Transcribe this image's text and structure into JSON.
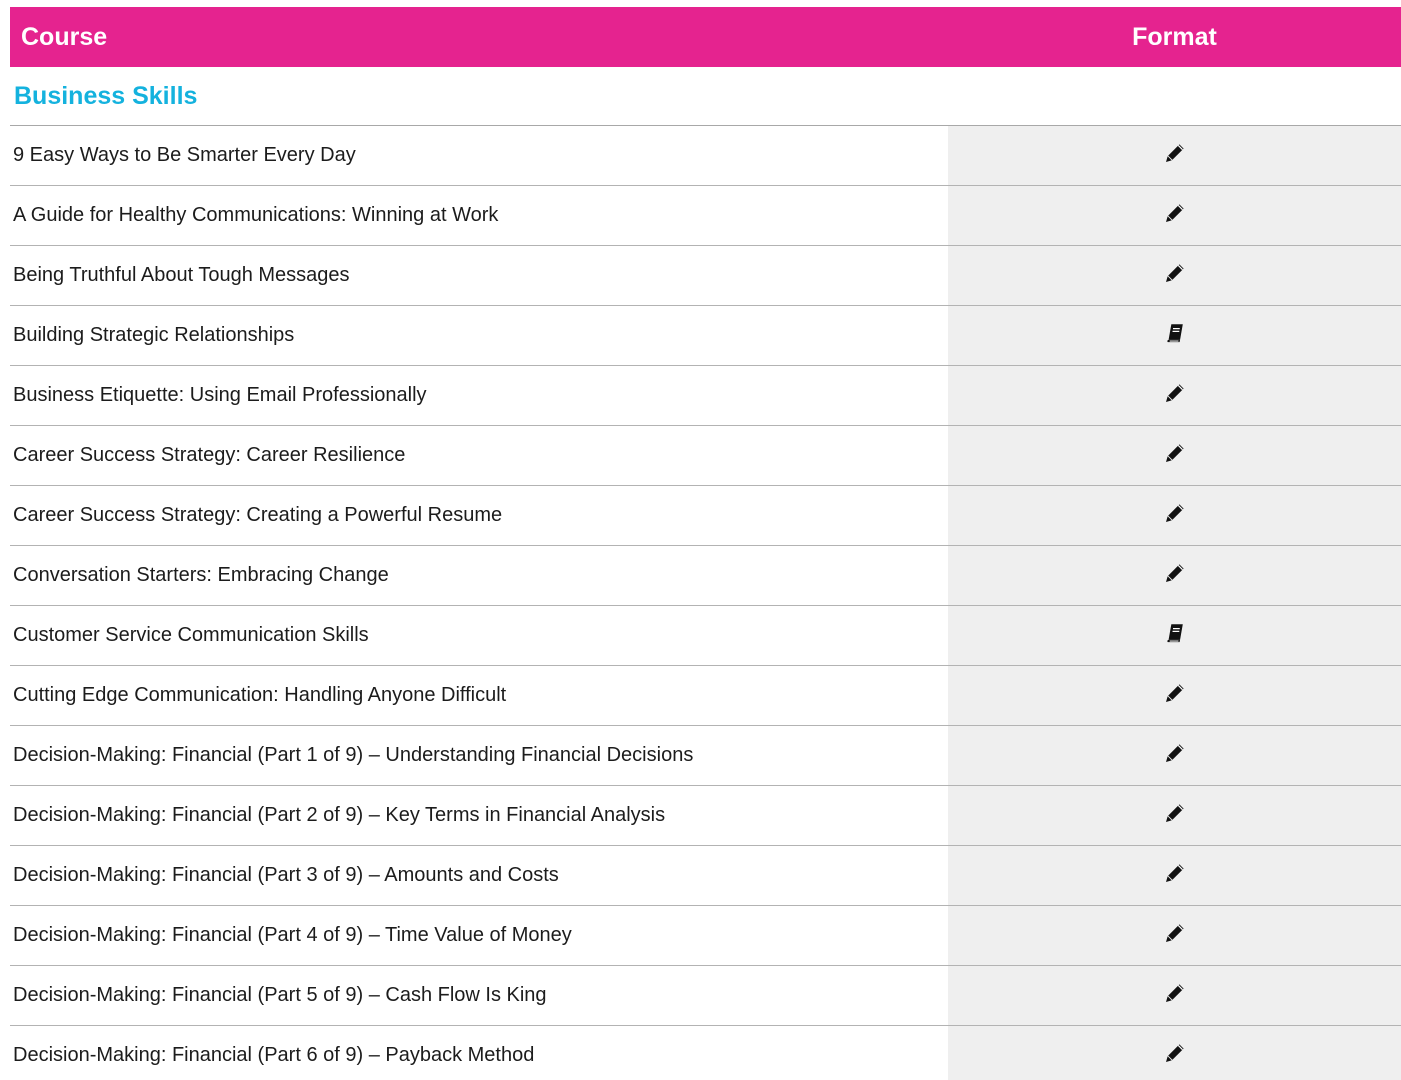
{
  "table": {
    "header": {
      "course": "Course",
      "format": "Format"
    },
    "section_title": "Business Skills",
    "rows": [
      {
        "course": "9 Easy Ways to Be Smarter Every Day",
        "format_icon": "pencil-icon"
      },
      {
        "course": "A Guide for Healthy Communications: Winning at Work",
        "format_icon": "pencil-icon"
      },
      {
        "course": "Being Truthful About Tough Messages",
        "format_icon": "pencil-icon"
      },
      {
        "course": "Building Strategic Relationships",
        "format_icon": "book-icon"
      },
      {
        "course": "Business Etiquette: Using Email Professionally",
        "format_icon": "pencil-icon"
      },
      {
        "course": "Career Success Strategy: Career Resilience",
        "format_icon": "pencil-icon"
      },
      {
        "course": "Career Success Strategy: Creating a Powerful Resume",
        "format_icon": "pencil-icon"
      },
      {
        "course": "Conversation Starters: Embracing Change",
        "format_icon": "pencil-icon"
      },
      {
        "course": "Customer Service Communication Skills",
        "format_icon": "book-icon"
      },
      {
        "course": "Cutting Edge Communication: Handling Anyone Difficult",
        "format_icon": "pencil-icon"
      },
      {
        "course": "Decision-Making: Financial (Part 1 of 9) – Understanding Financial Decisions",
        "format_icon": "pencil-icon"
      },
      {
        "course": "Decision-Making: Financial (Part 2 of 9) – Key Terms in Financial Analysis",
        "format_icon": "pencil-icon"
      },
      {
        "course": "Decision-Making: Financial (Part 3 of 9) – Amounts and Costs",
        "format_icon": "pencil-icon"
      },
      {
        "course": "Decision-Making: Financial (Part 4 of 9) – Time Value of Money",
        "format_icon": "pencil-icon"
      },
      {
        "course": "Decision-Making: Financial (Part 5 of 9) – Cash Flow Is King",
        "format_icon": "pencil-icon"
      },
      {
        "course": "Decision-Making: Financial (Part 6 of 9) – Payback Method",
        "format_icon": "pencil-icon"
      }
    ]
  },
  "colors": {
    "header_background": "#e5238f",
    "section_title": "#14b2de",
    "format_column_background": "#efefef"
  }
}
